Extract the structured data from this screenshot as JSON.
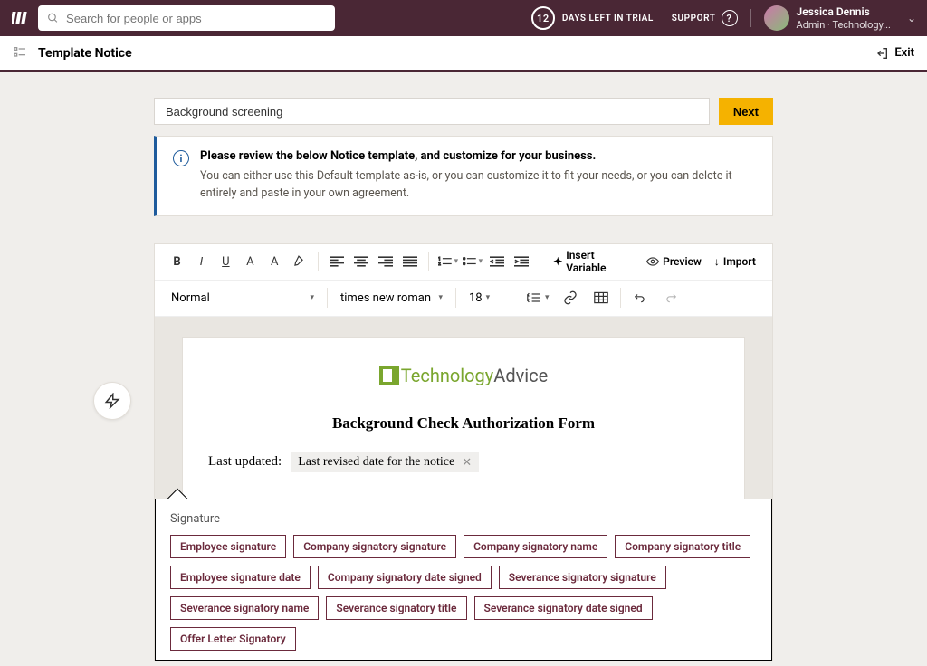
{
  "header": {
    "search_placeholder": "Search for people or apps",
    "trial_days": "12",
    "trial_label": "DAYS LEFT IN TRIAL",
    "support_label": "SUPPORT",
    "user_name": "Jessica Dennis",
    "user_role": "Admin · Technology..."
  },
  "subheader": {
    "title": "Template Notice",
    "exit_label": "Exit"
  },
  "form": {
    "title_value": "Background screening",
    "next_label": "Next"
  },
  "notice": {
    "title": "Please review the below Notice template, and customize for your business.",
    "body": "You can either use this Default template as-is, or you can customize it to fit your needs, or you can delete it entirely and paste in your own agreement."
  },
  "toolbar": {
    "insert_variable": "Insert Variable",
    "preview": "Preview",
    "import": "Import",
    "style_select": "Normal",
    "font_select": "times new roman",
    "size_select": "18"
  },
  "document": {
    "brand_part1": "Technology",
    "brand_part2": "Advice",
    "title": "Background Check Authorization Form",
    "updated_label": "Last updated:",
    "updated_chip": "Last revised date for the notice"
  },
  "popover": {
    "title": "Signature",
    "tags": [
      "Employee signature",
      "Company signatory signature",
      "Company signatory name",
      "Company signatory title",
      "Employee signature date",
      "Company signatory date signed",
      "Severance signatory signature",
      "Severance signatory name",
      "Severance signatory title",
      "Severance signatory date signed",
      "Offer Letter Signatory"
    ]
  }
}
